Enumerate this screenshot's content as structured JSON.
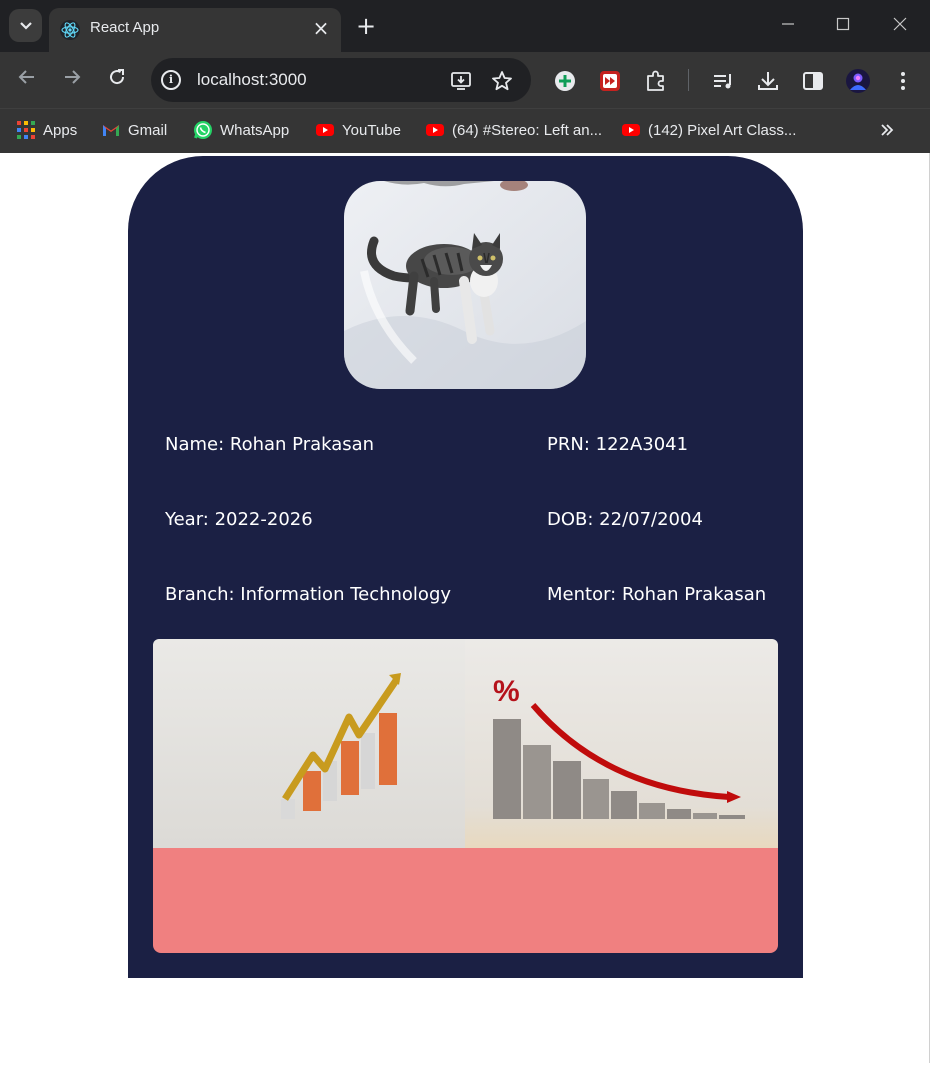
{
  "browser": {
    "tab_title": "React App",
    "url": "localhost:3000",
    "bookmarks": [
      {
        "label": "Apps",
        "icon": "apps-grid-icon"
      },
      {
        "label": "Gmail",
        "icon": "gmail-icon"
      },
      {
        "label": "WhatsApp",
        "icon": "whatsapp-icon"
      },
      {
        "label": "YouTube",
        "icon": "youtube-icon"
      },
      {
        "label": "(64) #Stereo: Left an...",
        "icon": "youtube-icon"
      },
      {
        "label": "(142) Pixel Art Class...",
        "icon": "youtube-icon"
      }
    ]
  },
  "profile": {
    "photo": "cat-in-snow-photo",
    "name": "Name: Rohan Prakasan",
    "prn": "PRN: 122A3041",
    "year": "Year: 2022-2026",
    "dob": "DOB: 22/07/2004",
    "branch": "Branch: Information Technology",
    "mentor": "Mentor: Rohan Prakasan"
  },
  "images": {
    "left": "rising-bar-chart-with-arrow-photo",
    "right": "coin-stacks-with-falling-percent-arrow-photo",
    "right_symbol": "%"
  },
  "colors": {
    "card_bg": "#1b2044",
    "footer_box": "#f08080",
    "chrome_bg": "#353535"
  }
}
